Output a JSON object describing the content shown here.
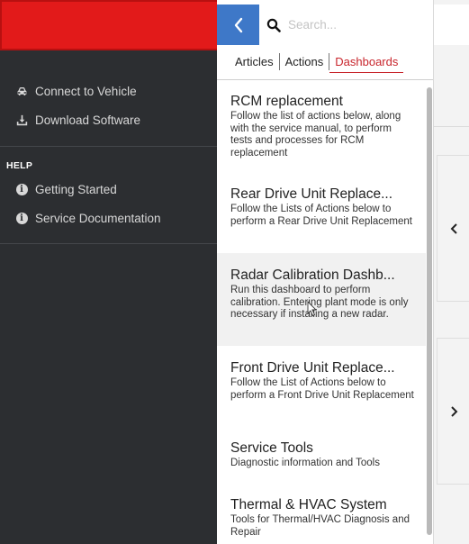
{
  "sidebar": {
    "brand_color": "#e21a1a",
    "items": [
      {
        "label": "Connect to Vehicle",
        "icon": "car-icon"
      },
      {
        "label": "Download Software",
        "icon": "download-icon"
      }
    ],
    "help_heading": "HELP",
    "help_items": [
      {
        "label": "Getting Started",
        "icon": "info-icon"
      },
      {
        "label": "Service Documentation",
        "icon": "info-icon"
      }
    ]
  },
  "panel": {
    "back_icon": "chevron-left-icon",
    "search": {
      "placeholder": "Search...",
      "value": ""
    },
    "tabs": [
      {
        "label": "Articles",
        "active": false
      },
      {
        "label": "Actions",
        "active": false
      },
      {
        "label": "Dashboards",
        "active": true
      }
    ],
    "accent": "#c8252c",
    "cards": [
      {
        "title": "RCM replacement",
        "description": "Follow the list of actions below, along with the service manual, to perform tests and processes for RCM replacement"
      },
      {
        "title": "Rear Drive Unit Replace...",
        "description": "Follow the Lists of Actions below to perform a Rear Drive Unit Replacement"
      },
      {
        "title": "Radar Calibration Dashb...",
        "description": "Run this dashboard to perform calibration. Entering plant mode is only necessary if installing a new radar."
      },
      {
        "title": "Front Drive Unit Replace...",
        "description": "Follow the List of Actions below to perform a Front Drive Unit Replacement"
      },
      {
        "title": "Service Tools",
        "description": "Diagnostic information and Tools"
      },
      {
        "title": "Thermal & HVAC System",
        "description": "Tools for Thermal/HVAC Diagnosis and Repair"
      }
    ]
  },
  "right_strip": {
    "prev_icon": "chevron-left-icon",
    "next_icon": "chevron-right-icon"
  }
}
